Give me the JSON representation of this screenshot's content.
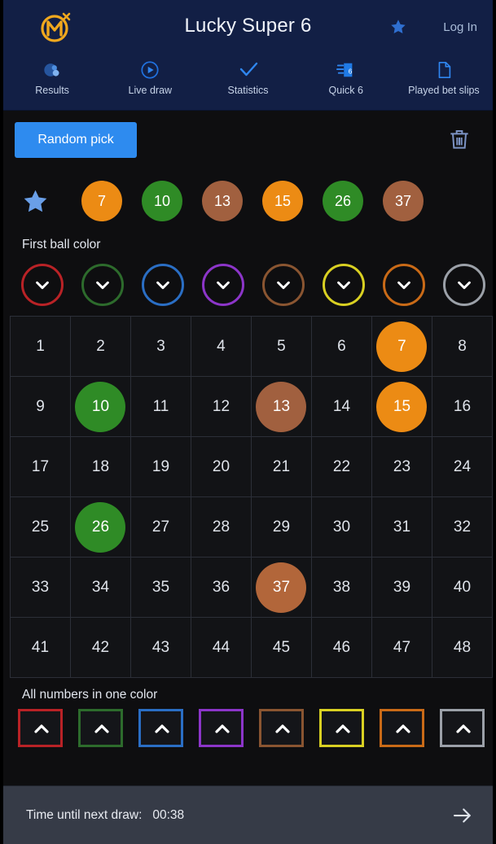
{
  "header": {
    "logo_icon": "brand-m-logo-icon",
    "title": "Lucky Super 6",
    "favorite_icon": "star-icon",
    "login_label": "Log In",
    "background_color": "#121f45",
    "nav": [
      {
        "icon": "results-drop-icon",
        "label": "Results"
      },
      {
        "icon": "play-circle-icon",
        "label": "Live draw"
      },
      {
        "icon": "check-icon",
        "label": "Statistics"
      },
      {
        "icon": "quick6-ticket-icon",
        "label": "Quick 6"
      },
      {
        "icon": "document-icon",
        "label": "Played bet slips"
      }
    ]
  },
  "toolbar": {
    "random_pick_label": "Random pick",
    "random_pick_color": "#2e8bef",
    "clear_icon": "trash-icon"
  },
  "picked": {
    "favorite_icon": "star-icon",
    "balls": [
      {
        "number": "7",
        "color": "#ec8b14"
      },
      {
        "number": "10",
        "color": "#2f8b26"
      },
      {
        "number": "13",
        "color": "#a1603f"
      },
      {
        "number": "15",
        "color": "#ec8b14"
      },
      {
        "number": "26",
        "color": "#2f8b26"
      },
      {
        "number": "37",
        "color": "#a1603f"
      }
    ]
  },
  "first_ball_color": {
    "label": "First ball color",
    "chevron_icon": "chevron-down-icon",
    "colors": [
      {
        "name": "red",
        "hex": "#b92226"
      },
      {
        "name": "green",
        "hex": "#2d6b2c"
      },
      {
        "name": "blue",
        "hex": "#2a6ec4"
      },
      {
        "name": "purple",
        "hex": "#8c35c9"
      },
      {
        "name": "brown",
        "hex": "#8a5531"
      },
      {
        "name": "yellow",
        "hex": "#d9d022"
      },
      {
        "name": "orange",
        "hex": "#c96a17"
      },
      {
        "name": "gray",
        "hex": "#9ba0a8"
      }
    ]
  },
  "grid": {
    "columns": 8,
    "rows": [
      [
        {
          "n": "1"
        },
        {
          "n": "2"
        },
        {
          "n": "3"
        },
        {
          "n": "4"
        },
        {
          "n": "5"
        },
        {
          "n": "6"
        },
        {
          "n": "7",
          "color": "#ec8b14"
        },
        {
          "n": "8"
        }
      ],
      [
        {
          "n": "9"
        },
        {
          "n": "10",
          "color": "#2f8b26"
        },
        {
          "n": "11"
        },
        {
          "n": "12"
        },
        {
          "n": "13",
          "color": "#a1603f"
        },
        {
          "n": "14"
        },
        {
          "n": "15",
          "color": "#ec8b14"
        },
        {
          "n": "16"
        }
      ],
      [
        {
          "n": "17"
        },
        {
          "n": "18"
        },
        {
          "n": "19"
        },
        {
          "n": "20"
        },
        {
          "n": "21"
        },
        {
          "n": "22"
        },
        {
          "n": "23"
        },
        {
          "n": "24"
        }
      ],
      [
        {
          "n": "25"
        },
        {
          "n": "26",
          "color": "#2f8b26"
        },
        {
          "n": "27"
        },
        {
          "n": "28"
        },
        {
          "n": "29"
        },
        {
          "n": "30"
        },
        {
          "n": "31"
        },
        {
          "n": "32"
        }
      ],
      [
        {
          "n": "33"
        },
        {
          "n": "34"
        },
        {
          "n": "35"
        },
        {
          "n": "36"
        },
        {
          "n": "37",
          "color": "#b2663a"
        },
        {
          "n": "38"
        },
        {
          "n": "39"
        },
        {
          "n": "40"
        }
      ],
      [
        {
          "n": "41"
        },
        {
          "n": "42"
        },
        {
          "n": "43"
        },
        {
          "n": "44"
        },
        {
          "n": "45"
        },
        {
          "n": "46"
        },
        {
          "n": "47"
        },
        {
          "n": "48"
        }
      ]
    ]
  },
  "all_numbers_color": {
    "label": "All numbers in one color",
    "chevron_icon": "chevron-up-icon",
    "colors": [
      {
        "name": "red",
        "hex": "#b92226"
      },
      {
        "name": "green",
        "hex": "#2d6b2c"
      },
      {
        "name": "blue",
        "hex": "#2a6ec4"
      },
      {
        "name": "purple",
        "hex": "#8c35c9"
      },
      {
        "name": "brown",
        "hex": "#8a5531"
      },
      {
        "name": "yellow",
        "hex": "#d9d022"
      },
      {
        "name": "orange",
        "hex": "#c96a17"
      },
      {
        "name": "gray",
        "hex": "#9ba0a8"
      }
    ]
  },
  "footer": {
    "label": "Time until next draw:",
    "timer": "00:38",
    "next_icon": "arrow-right-icon",
    "background_color": "#363b47"
  }
}
